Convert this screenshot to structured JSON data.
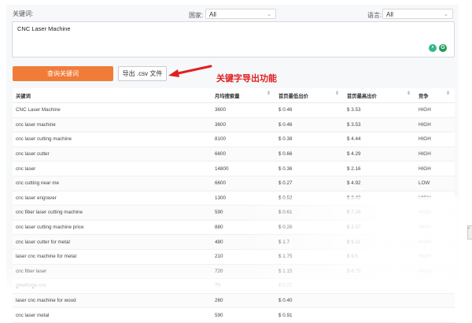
{
  "filters": {
    "keyword_label": "关键词:",
    "country_label": "国家:",
    "country_value": "All",
    "language_label": "语言:",
    "language_value": "All",
    "keyword_input": "CNC Laser Machine"
  },
  "buttons": {
    "query": "查询关键词",
    "export": "导出 .csv 文件"
  },
  "annotation": "关键字导出功能",
  "colors": {
    "accent": "#f17c3a",
    "annotation": "#e02020"
  },
  "table": {
    "headers": [
      "关键词",
      "月均搜索量",
      "首页最低出价",
      "首页最高出价",
      "竞争"
    ],
    "rows": [
      [
        "CNC Laser Machine",
        "3600",
        "$ 0.46",
        "$ 3.53",
        "HIGH"
      ],
      [
        "cnc laser machine",
        "3600",
        "$ 0.46",
        "$ 3.53",
        "HIGH"
      ],
      [
        "cnc laser cutting machine",
        "8100",
        "$ 0.38",
        "$ 4.44",
        "HIGH"
      ],
      [
        "cnc laser cutter",
        "6600",
        "$ 0.66",
        "$ 4.29",
        "HIGH"
      ],
      [
        "cnc laser",
        "14800",
        "$ 0.36",
        "$ 2.16",
        "HIGH"
      ],
      [
        "cnc cutting near me",
        "6600",
        "$ 0.27",
        "$ 4.92",
        "LOW"
      ],
      [
        "cnc laser engraver",
        "1300",
        "$ 0.52",
        "$ 3.42",
        "HIGH"
      ],
      [
        "cnc fiber laser cutting machine",
        "590",
        "$ 0.61",
        "$ 7.28",
        "HIGH"
      ],
      [
        "cnc laser cutting machine price",
        "880",
        "$ 0.26",
        "$ 2.57",
        "HIGH"
      ],
      [
        "cnc laser cutter for metal",
        "480",
        "$ 1.7",
        "$ 9.11",
        "HIGH"
      ],
      [
        "laser cnc machine for metal",
        "210",
        "$ 1.75",
        "$ 9.5",
        "HIGH"
      ],
      [
        "cnc fiber laser",
        "720",
        "$ 1.15",
        "$ 8.75",
        "HIGH"
      ],
      [
        "glowforge cnc",
        "70",
        "$ 0.27",
        "",
        ""
      ],
      [
        "laser cnc machine for wood",
        "260",
        "$ 0.40",
        "",
        ""
      ],
      [
        "cnc laser metal",
        "590",
        "$ 0.91",
        "",
        ""
      ]
    ]
  }
}
